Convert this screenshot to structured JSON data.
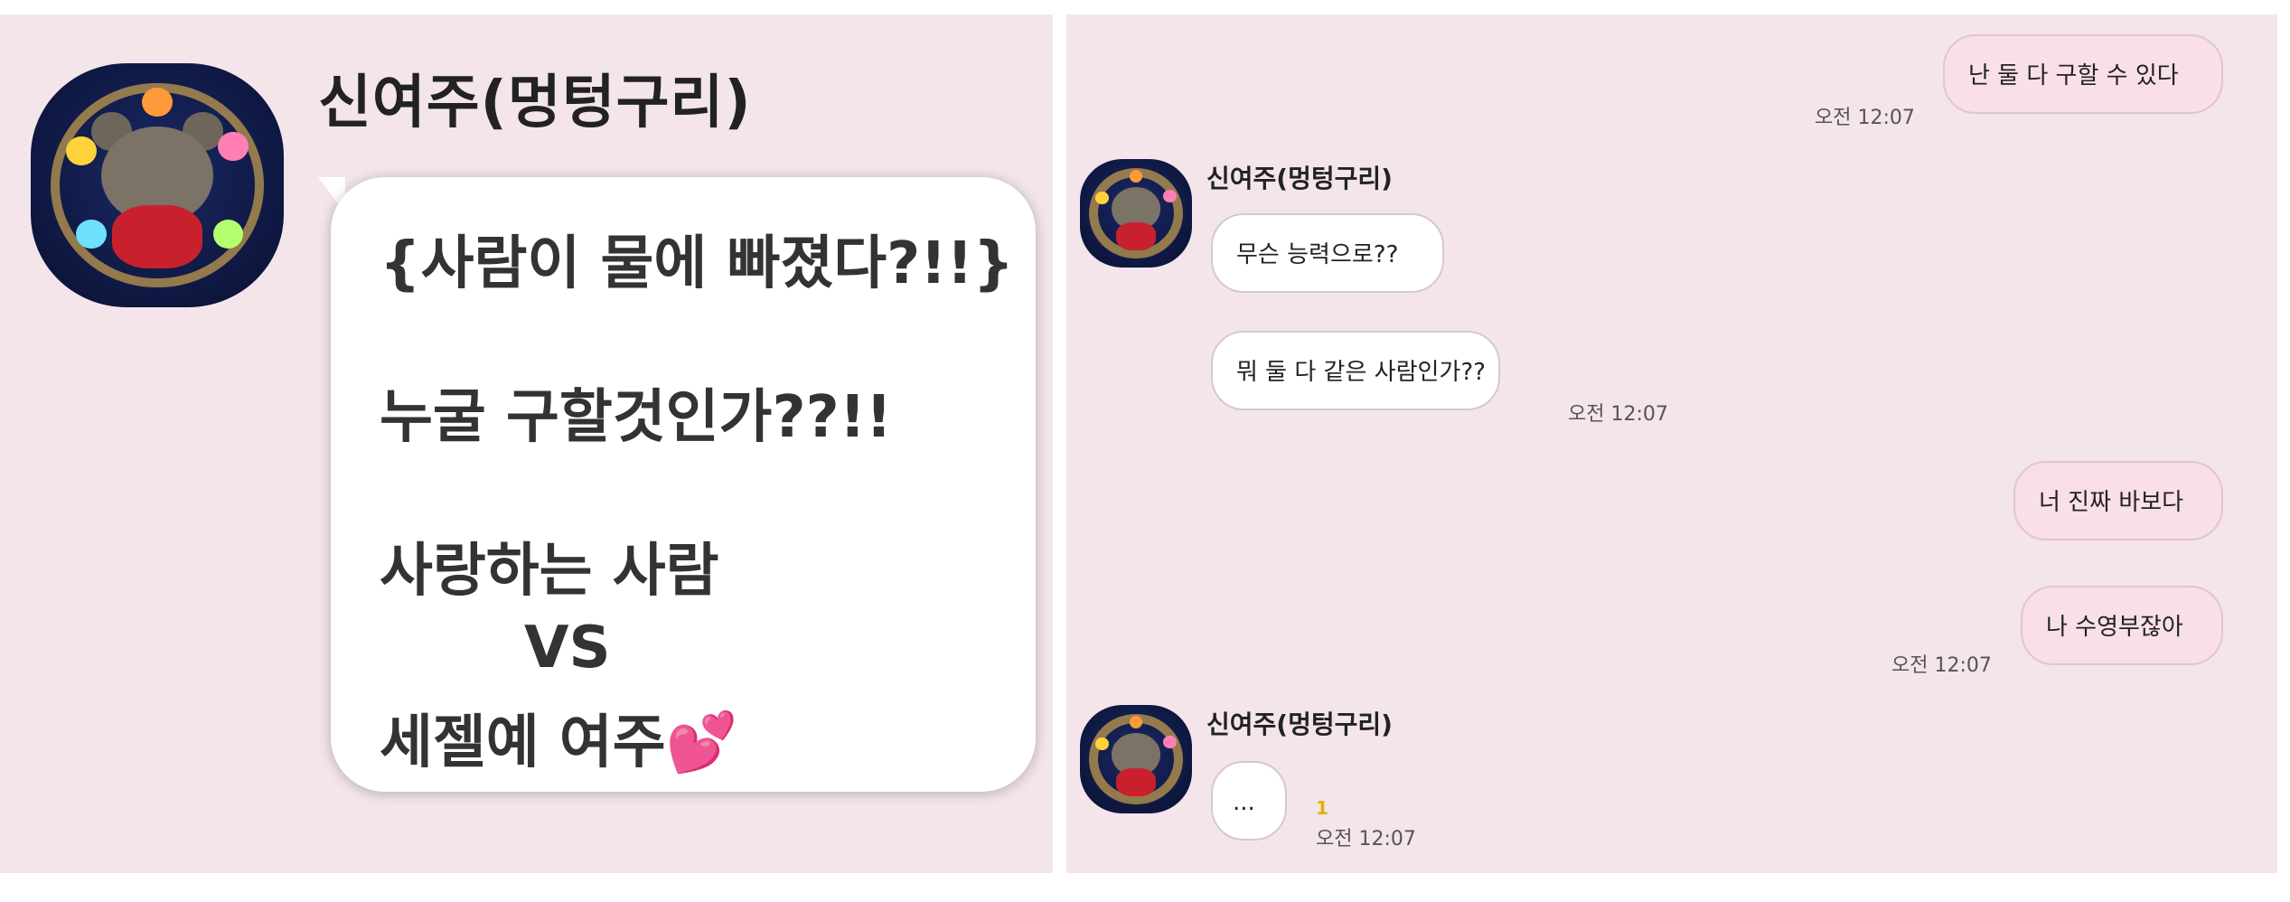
{
  "left": {
    "sender_name": "신여주(멍텅구리)",
    "big_message_lines": [
      "{사람이 물에 빠졌다?!!}",
      "누굴 구할것인가??!!",
      "사랑하는 사람",
      "VS",
      "세젤예 여주💕"
    ]
  },
  "chat": {
    "messages": [
      {
        "side": "mine",
        "text": "난 둘 다 구할 수 있다",
        "time": "오전 12:07"
      },
      {
        "side": "theirs",
        "sender": "신여주(멍텅구리)",
        "text": "무슨 능력으로??"
      },
      {
        "side": "theirs",
        "text": "뭐 둘 다 같은 사람인가??",
        "time": "오전 12:07"
      },
      {
        "side": "mine",
        "text": "너 진짜 바보다"
      },
      {
        "side": "mine",
        "text": "나 수영부잖아",
        "time": "오전 12:07"
      },
      {
        "side": "theirs",
        "sender": "신여주(멍텅구리)",
        "text": "...",
        "unread": "1",
        "time": "오전 12:07"
      }
    ]
  },
  "colors": {
    "background": "#f3e5ea",
    "my_bubble": "#f8dfe8",
    "their_bubble": "#ffffff",
    "unread_count": "#e3b300"
  }
}
